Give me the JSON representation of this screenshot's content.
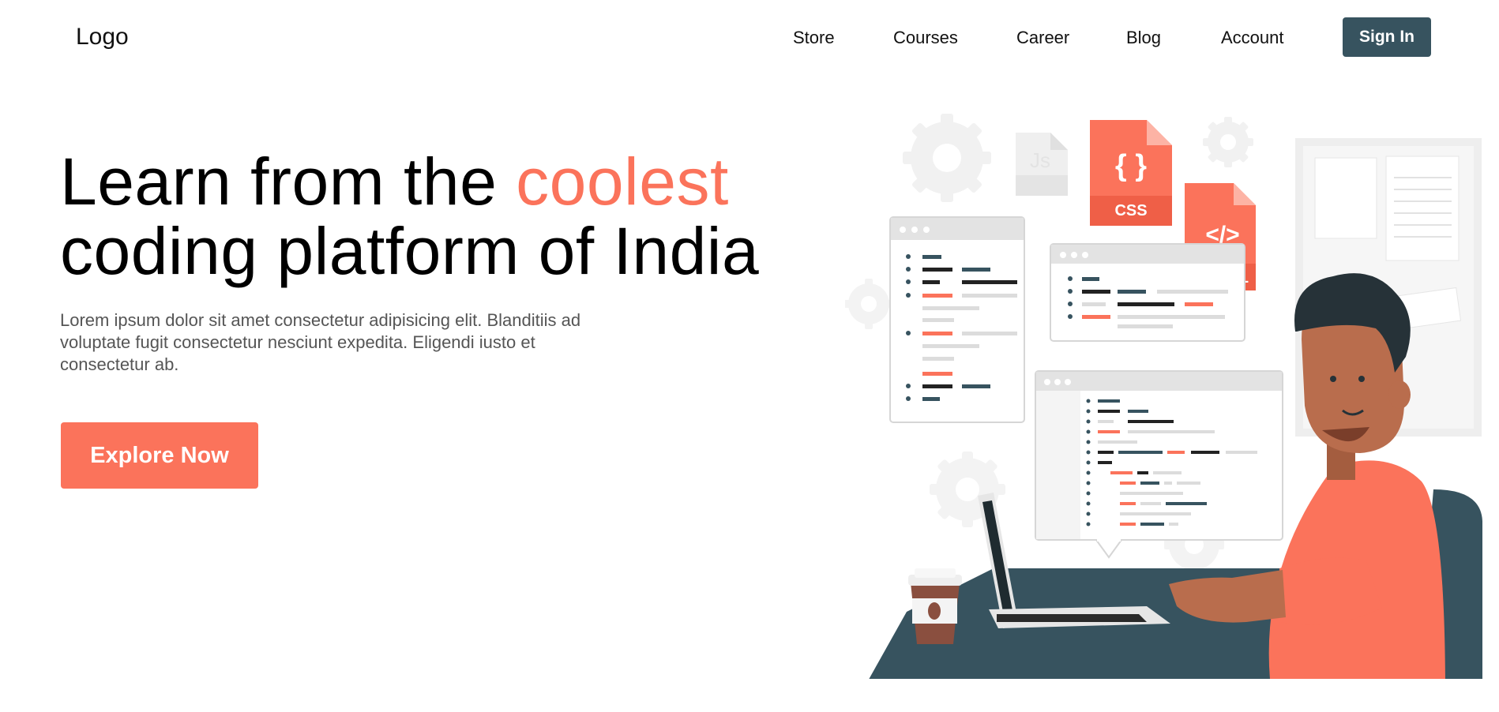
{
  "nav": {
    "logo": "Logo",
    "links": [
      "Store",
      "Courses",
      "Career",
      "Blog",
      "Account"
    ],
    "sign_in_label": "Sign In"
  },
  "hero": {
    "title_before": "Learn from the ",
    "title_accent": "coolest",
    "title_line2": "coding platform of India",
    "description": "Lorem ipsum dolor sit amet consectetur adipisicing elit. Blanditiis ad voluptate fugit consectetur nesciunt expedita. Eligendi iusto et consectetur ab.",
    "cta_label": "Explore Now"
  },
  "illustration": {
    "file_badges": [
      "{ }",
      "CSS",
      "</>",
      "ML",
      "Js"
    ]
  },
  "colors": {
    "accent": "#fb735b",
    "dark_teal": "#37535f",
    "text": "#111111",
    "muted_text": "#555555"
  }
}
